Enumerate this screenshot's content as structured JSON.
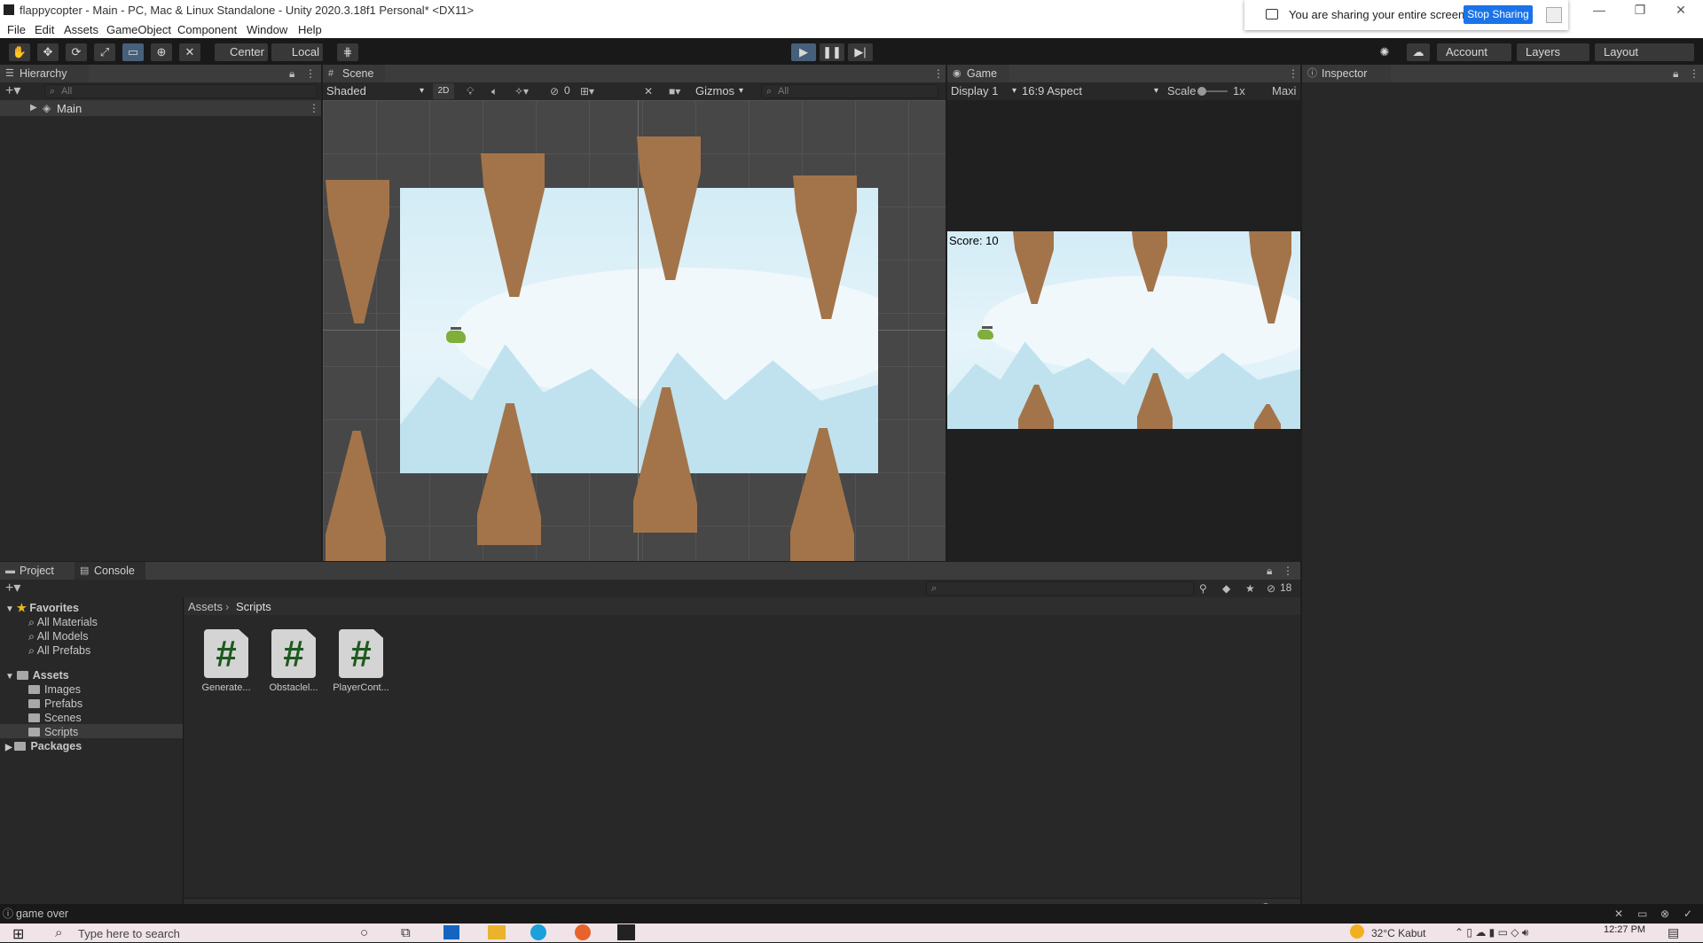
{
  "window": {
    "title": "flappycopter - Main - PC, Mac & Linux Standalone - Unity 2020.3.18f1 Personal* <DX11>"
  },
  "menu": [
    "File",
    "Edit",
    "Assets",
    "GameObject",
    "Component",
    "Window",
    "Help"
  ],
  "share": {
    "text": "You are sharing your entire screen.",
    "stop_label": "Stop Sharing"
  },
  "toolbar": {
    "pivot": "Center",
    "space": "Local",
    "account": "Account",
    "layers": "Layers",
    "layout": "Layout"
  },
  "hierarchy": {
    "tab": "Hierarchy",
    "search_placeholder": "All",
    "scene_item": "Main"
  },
  "scene": {
    "tab": "Scene",
    "shading": "Shaded",
    "mode2d": "2D",
    "hidden_count": "0",
    "gizmos": "Gizmos",
    "search_placeholder": "All"
  },
  "game": {
    "tab": "Game",
    "display": "Display 1",
    "aspect": "16:9 Aspect",
    "scale_label": "Scale",
    "scale_value": "1x",
    "maximize": "Maxi",
    "score": "Score: 10"
  },
  "inspector": {
    "tab": "Inspector"
  },
  "project": {
    "tab_project": "Project",
    "tab_console": "Console",
    "hidden_count": "18",
    "favorites_label": "Favorites",
    "favorites": [
      "All Materials",
      "All Models",
      "All Prefabs"
    ],
    "assets_label": "Assets",
    "asset_folders": [
      "Images",
      "Prefabs",
      "Scenes",
      "Scripts"
    ],
    "packages_label": "Packages",
    "breadcrumb_root": "Assets",
    "breadcrumb_current": "Scripts",
    "files": [
      {
        "name": "Generate...",
        "glyph": "#"
      },
      {
        "name": "Obstaclel...",
        "glyph": "#"
      },
      {
        "name": "PlayerCont...",
        "glyph": "#"
      }
    ]
  },
  "status": {
    "message": "game over"
  },
  "taskbar": {
    "search_placeholder": "Type here to search",
    "weather": "32°C  Kabut",
    "time": "12:27 PM"
  },
  "colors": {
    "accent": "#46607c",
    "share_button": "#1a73e8",
    "rock": "#a3744a",
    "sky": "#d3ecf6",
    "script_hash": "#1e5a1e"
  }
}
